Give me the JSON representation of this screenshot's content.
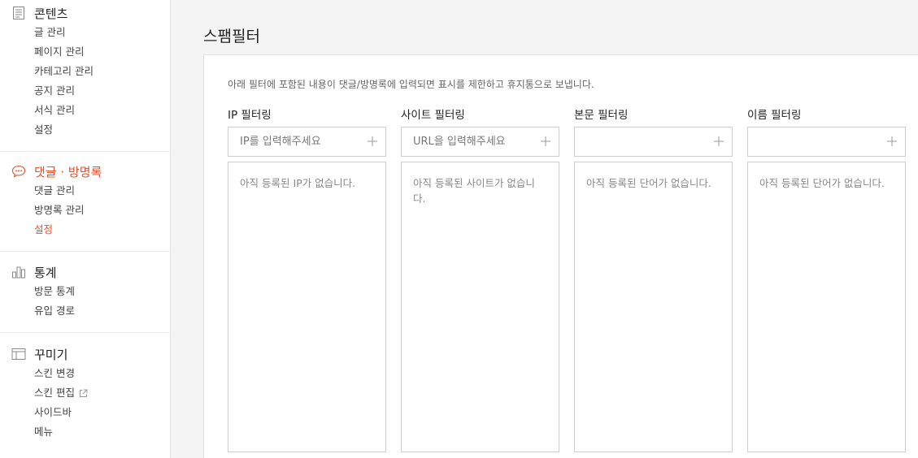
{
  "sidebar": {
    "groups": [
      {
        "title": "콘텐츠",
        "icon": "document-icon",
        "items": [
          {
            "label": "글 관리"
          },
          {
            "label": "페이지 관리"
          },
          {
            "label": "카테고리 관리"
          },
          {
            "label": "공지 관리"
          },
          {
            "label": "서식 관리"
          },
          {
            "label": "설정"
          }
        ]
      },
      {
        "title": "댓글 · 방명록",
        "icon": "comment-bubble-icon",
        "active": true,
        "items": [
          {
            "label": "댓글 관리"
          },
          {
            "label": "방명록 관리"
          },
          {
            "label": "설정",
            "active": true
          }
        ]
      },
      {
        "title": "통계",
        "icon": "bar-chart-icon",
        "items": [
          {
            "label": "방문 통계"
          },
          {
            "label": "유입 경로"
          }
        ]
      },
      {
        "title": "꾸미기",
        "icon": "layout-icon",
        "items": [
          {
            "label": "스킨 변경"
          },
          {
            "label": "스킨 편집",
            "external": true
          },
          {
            "label": "사이드바"
          },
          {
            "label": "메뉴"
          }
        ]
      }
    ]
  },
  "main": {
    "title": "스팸필터",
    "description": "아래 필터에 포함된 내용이 댓글/방명록에 입력되면 표시를 제한하고 휴지통으로 보냅니다.",
    "filters": [
      {
        "label": "IP 필터링",
        "placeholder": "IP를 입력해주세요",
        "empty": "아직 등록된 IP가 없습니다."
      },
      {
        "label": "사이트 필터링",
        "placeholder": "URL을 입력해주세요",
        "empty": "아직 등록된 사이트가 없습니다."
      },
      {
        "label": "본문 필터링",
        "placeholder": "",
        "empty": "아직 등록된 단어가 없습니다."
      },
      {
        "label": "이름 필터링",
        "placeholder": "",
        "empty": "아직 등록된 단어가 없습니다."
      }
    ]
  },
  "colors": {
    "accent": "#e8502e",
    "border": "#cfcfcf",
    "background": "#f4f4f4"
  }
}
